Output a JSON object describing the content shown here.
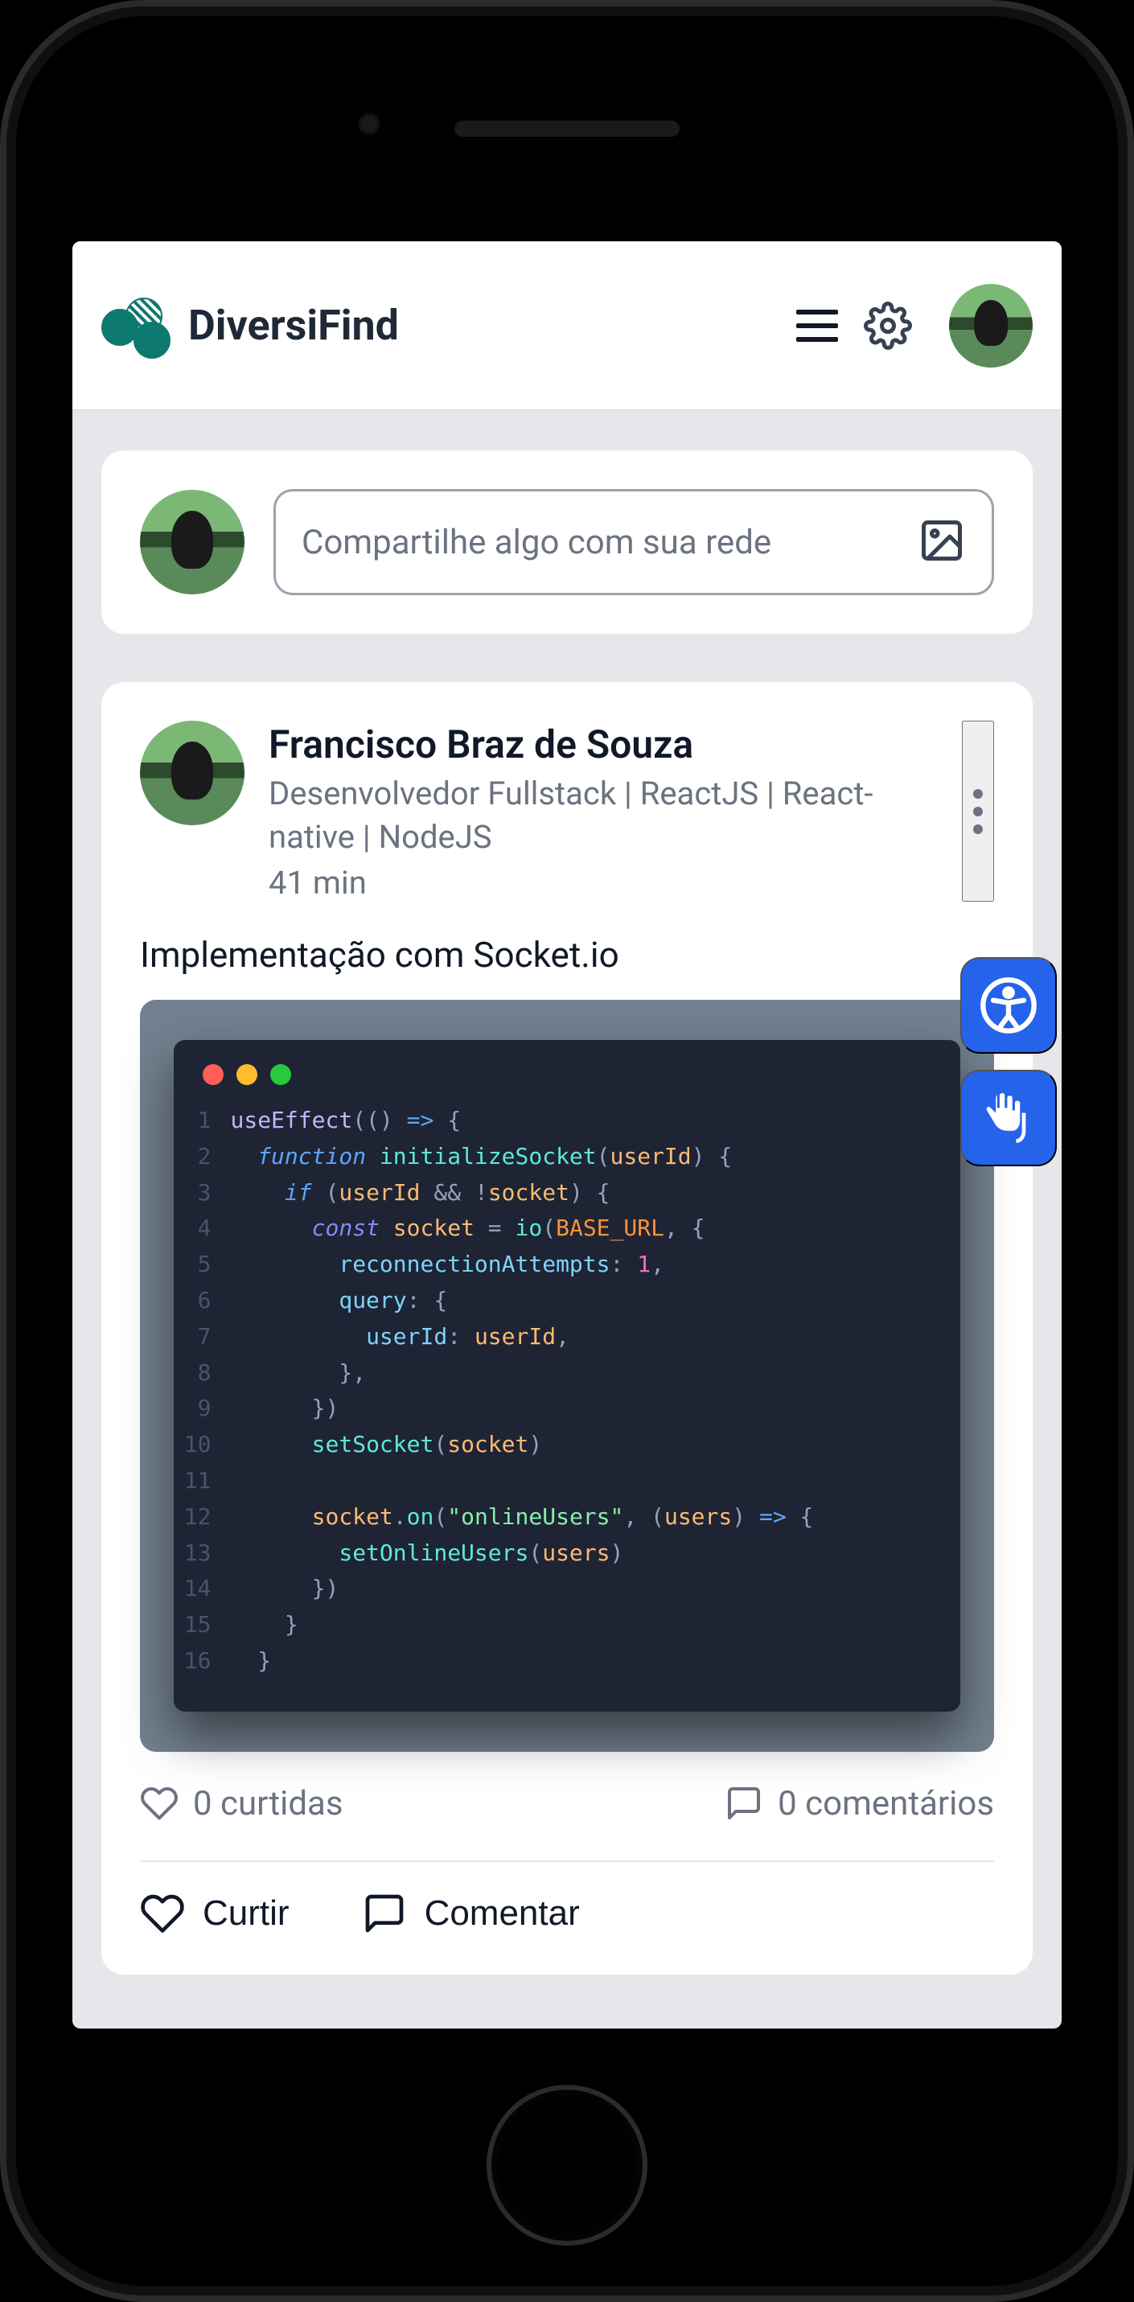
{
  "brand": "DiversiFind",
  "compose": {
    "placeholder": "Compartilhe algo com sua rede"
  },
  "post": {
    "author": "Francisco Braz de Souza",
    "role": "Desenvolvedor Fullstack | ReactJS | React-native | NodeJS",
    "time": "41 min",
    "caption": "Implementação com Socket.io",
    "likes_text": "0 curtidas",
    "comments_text": "0 comentários",
    "like_label": "Curtir",
    "comment_label": "Comentar",
    "code_lines": [
      [
        {
          "c": "tk-call",
          "t": "useEffect"
        },
        {
          "c": "tk-p",
          "t": "(() "
        },
        {
          "c": "tk-kw",
          "t": "=>"
        },
        {
          "c": "tk-p",
          "t": " {"
        }
      ],
      [
        {
          "c": "tk-p",
          "t": "  "
        },
        {
          "c": "tk-kw",
          "t": "function"
        },
        {
          "c": "tk-p",
          "t": " "
        },
        {
          "c": "tk-fn",
          "t": "initializeSocket"
        },
        {
          "c": "tk-p",
          "t": "("
        },
        {
          "c": "tk-var",
          "t": "userId"
        },
        {
          "c": "tk-p",
          "t": ") {"
        }
      ],
      [
        {
          "c": "tk-p",
          "t": "    "
        },
        {
          "c": "tk-kw",
          "t": "if"
        },
        {
          "c": "tk-p",
          "t": " ("
        },
        {
          "c": "tk-var",
          "t": "userId"
        },
        {
          "c": "tk-p",
          "t": " && !"
        },
        {
          "c": "tk-var",
          "t": "socket"
        },
        {
          "c": "tk-p",
          "t": ") {"
        }
      ],
      [
        {
          "c": "tk-p",
          "t": "      "
        },
        {
          "c": "tk-kw2",
          "t": "const"
        },
        {
          "c": "tk-p",
          "t": " "
        },
        {
          "c": "tk-var",
          "t": "socket"
        },
        {
          "c": "tk-p",
          "t": " = "
        },
        {
          "c": "tk-fn",
          "t": "io"
        },
        {
          "c": "tk-p",
          "t": "("
        },
        {
          "c": "tk-const",
          "t": "BASE_URL"
        },
        {
          "c": "tk-p",
          "t": ", {"
        }
      ],
      [
        {
          "c": "tk-p",
          "t": "        "
        },
        {
          "c": "tk-prop",
          "t": "reconnectionAttempts"
        },
        {
          "c": "tk-p",
          "t": ": "
        },
        {
          "c": "tk-num",
          "t": "1"
        },
        {
          "c": "tk-p",
          "t": ","
        }
      ],
      [
        {
          "c": "tk-p",
          "t": "        "
        },
        {
          "c": "tk-prop",
          "t": "query"
        },
        {
          "c": "tk-p",
          "t": ": {"
        }
      ],
      [
        {
          "c": "tk-p",
          "t": "          "
        },
        {
          "c": "tk-prop",
          "t": "userId"
        },
        {
          "c": "tk-p",
          "t": ": "
        },
        {
          "c": "tk-var",
          "t": "userId"
        },
        {
          "c": "tk-p",
          "t": ","
        }
      ],
      [
        {
          "c": "tk-p",
          "t": "        },"
        }
      ],
      [
        {
          "c": "tk-p",
          "t": "      })"
        }
      ],
      [
        {
          "c": "tk-p",
          "t": "      "
        },
        {
          "c": "tk-fn",
          "t": "setSocket"
        },
        {
          "c": "tk-p",
          "t": "("
        },
        {
          "c": "tk-var",
          "t": "socket"
        },
        {
          "c": "tk-p",
          "t": ")"
        }
      ],
      [
        {
          "c": "tk-p",
          "t": ""
        }
      ],
      [
        {
          "c": "tk-p",
          "t": "      "
        },
        {
          "c": "tk-var",
          "t": "socket"
        },
        {
          "c": "tk-p",
          "t": "."
        },
        {
          "c": "tk-fn",
          "t": "on"
        },
        {
          "c": "tk-p",
          "t": "("
        },
        {
          "c": "tk-str",
          "t": "\"onlineUsers\""
        },
        {
          "c": "tk-p",
          "t": ", ("
        },
        {
          "c": "tk-var",
          "t": "users"
        },
        {
          "c": "tk-p",
          "t": ") "
        },
        {
          "c": "tk-kw",
          "t": "=>"
        },
        {
          "c": "tk-p",
          "t": " {"
        }
      ],
      [
        {
          "c": "tk-p",
          "t": "        "
        },
        {
          "c": "tk-fn",
          "t": "setOnlineUsers"
        },
        {
          "c": "tk-p",
          "t": "("
        },
        {
          "c": "tk-var",
          "t": "users"
        },
        {
          "c": "tk-p",
          "t": ")"
        }
      ],
      [
        {
          "c": "tk-p",
          "t": "      })"
        }
      ],
      [
        {
          "c": "tk-p",
          "t": "    }"
        }
      ],
      [
        {
          "c": "tk-p",
          "t": "  }"
        }
      ]
    ]
  }
}
